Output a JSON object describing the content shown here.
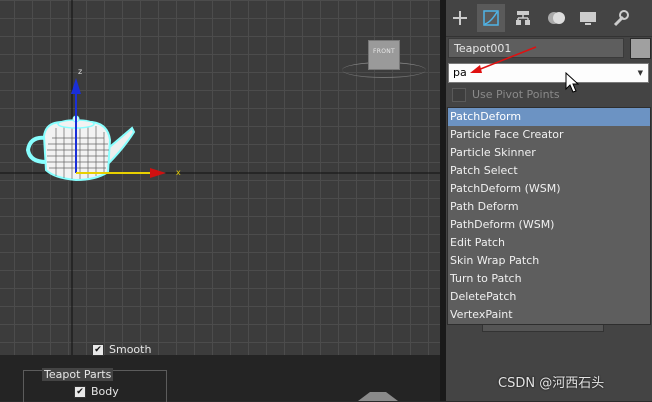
{
  "viewport": {
    "viewcube_label": "FRONT",
    "axis_labels": {
      "x": "x",
      "z": "z"
    }
  },
  "command_panel": {
    "tabs": [
      {
        "name": "create",
        "icon": "plus-icon"
      },
      {
        "name": "modify",
        "icon": "modify-icon",
        "active": true
      },
      {
        "name": "hierarchy",
        "icon": "hierarchy-icon"
      },
      {
        "name": "motion",
        "icon": "motion-icon"
      },
      {
        "name": "display",
        "icon": "display-icon"
      },
      {
        "name": "utilities",
        "icon": "wrench-icon"
      }
    ],
    "object_name": "Teapot001",
    "object_color": "#a0a0a0",
    "modifier_list_value": "pa",
    "use_pivot_points": "Use Pivot Points",
    "smooth_label": "Smooth",
    "smooth_checked": true,
    "teapot_parts_label": "Teapot Parts",
    "body_label": "Body",
    "body_checked": true
  },
  "dropdown": {
    "items": [
      "PatchDeform",
      "Particle Face Creator",
      "Particle Skinner",
      "Patch Select",
      "PatchDeform (WSM)",
      "Path Deform",
      "PathDeform (WSM)",
      "Edit Patch",
      "Skin Wrap Patch",
      "Turn to Patch",
      "DeletePatch",
      "VertexPaint"
    ],
    "selected_index": 0,
    "selected_color": "#6c93c3"
  },
  "watermark": "CSDN @河西石头"
}
